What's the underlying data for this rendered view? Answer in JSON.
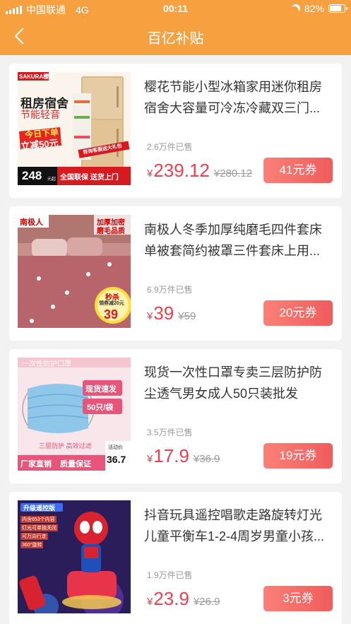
{
  "status_bar": {
    "carrier": "中国联通",
    "network": "4G",
    "time": "00:11",
    "battery": "82%",
    "battery_level": 0.82
  },
  "nav": {
    "title": "百亿补贴",
    "back_icon": "chevron-left-icon"
  },
  "colors": {
    "header": "#f7a03f",
    "price": "#ee3f4d",
    "coupon_start": "#fa8078",
    "coupon_end": "#f05c5c"
  },
  "products": [
    {
      "title": "樱花节能小型冰箱家用迷你租房宿舍大容量可冷冻冷藏双三门...",
      "sold": "2.6万件已售",
      "currency": "¥",
      "price": "239.12",
      "original": "¥280.12",
      "coupon": "41元券",
      "image": {
        "brand": "SAKURA樱花",
        "line1": "租房宿舍",
        "line2": "节能轻音",
        "line3": "今日下单",
        "line4": "立减50元",
        "tag": "咨询客服送大礼包",
        "price": "248",
        "unit": "元起",
        "bottom": "全国联保 送货上门"
      }
    },
    {
      "title": "南极人冬季加厚纯磨毛四件套床单被套简约被罩三件套床上用...",
      "sold": "6.9万件已售",
      "currency": "¥",
      "price": "39",
      "original": "¥59",
      "coupon": "20元券",
      "image": {
        "brand": "南极人",
        "tag1": "加厚加密",
        "tag2": "磨毛品质",
        "badge1": "秒杀",
        "badge2": "领券减20元",
        "price": "39"
      }
    },
    {
      "title": "现货一次性口罩专卖三层防护防尘透气男女成人50只装批发",
      "sold": "3.5万件已售",
      "currency": "¥",
      "price": "17.9",
      "original": "¥36.9",
      "coupon": "19元券",
      "image": {
        "header": "一次性防护口罩",
        "tag1": "现货速发",
        "tag2": "50只/袋",
        "features": "三层防护 高效过滤",
        "bottom1": "厂家直销",
        "bottom2": "质量保证",
        "price_label": "活动价",
        "price": "36.7"
      }
    },
    {
      "title": "抖音玩具遥控唱歌走路旋转灯光儿童平衡车1-2-4周岁男童小孩...",
      "sold": "1.9万件已售",
      "currency": "¥",
      "price": "23.9",
      "original": "¥26.9",
      "coupon": "3元券",
      "image": {
        "header": "升级遥控版",
        "f1": "内含653个内容",
        "f2": "灯光可单独关闭",
        "f3": "可万向行走",
        "f4": "360°旋转"
      }
    }
  ]
}
